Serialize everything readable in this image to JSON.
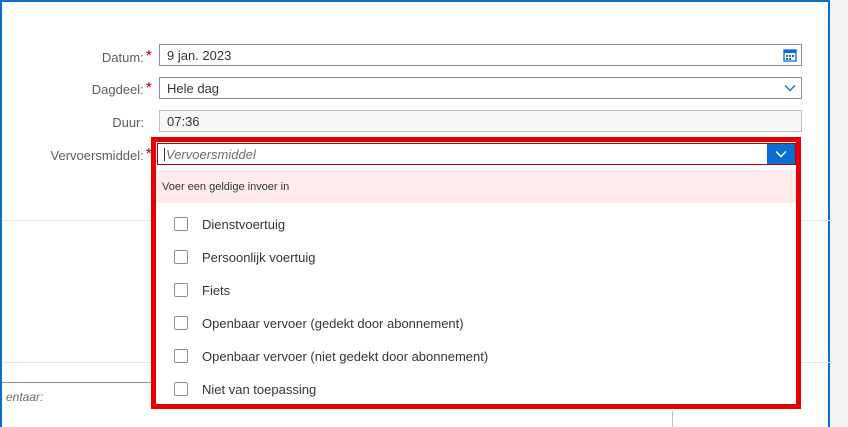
{
  "form": {
    "datum": {
      "label": "Datum:",
      "required_mark": "*",
      "value": "9 jan. 2023",
      "icon": "calendar-icon"
    },
    "dagdeel": {
      "label": "Dagdeel:",
      "required_mark": "*",
      "value": "Hele dag",
      "icon": "chevron-down-icon"
    },
    "duur": {
      "label": "Duur:",
      "value": "07:36"
    },
    "vervoersmiddel": {
      "label": "Vervoersmiddel:",
      "required_mark": "*",
      "placeholder": "Vervoersmiddel",
      "icon": "chevron-down-icon"
    }
  },
  "comment": {
    "label": "entaar:"
  },
  "dropdown": {
    "error_message": "Voer een geldige invoer in",
    "options": [
      {
        "label": "Dienstvoertuig",
        "checked": false
      },
      {
        "label": "Persoonlijk voertuig",
        "checked": false
      },
      {
        "label": "Fiets",
        "checked": false
      },
      {
        "label": "Openbaar vervoer (gedekt door abonnement)",
        "checked": false
      },
      {
        "label": "Openbaar vervoer (niet gedekt door abonnement)",
        "checked": false
      },
      {
        "label": "Niet van toepassing",
        "checked": false
      }
    ]
  },
  "colors": {
    "accent": "#0a6ed1",
    "error": "#bb0000",
    "highlight": "#e40000",
    "error_bg": "#ffebeb"
  }
}
